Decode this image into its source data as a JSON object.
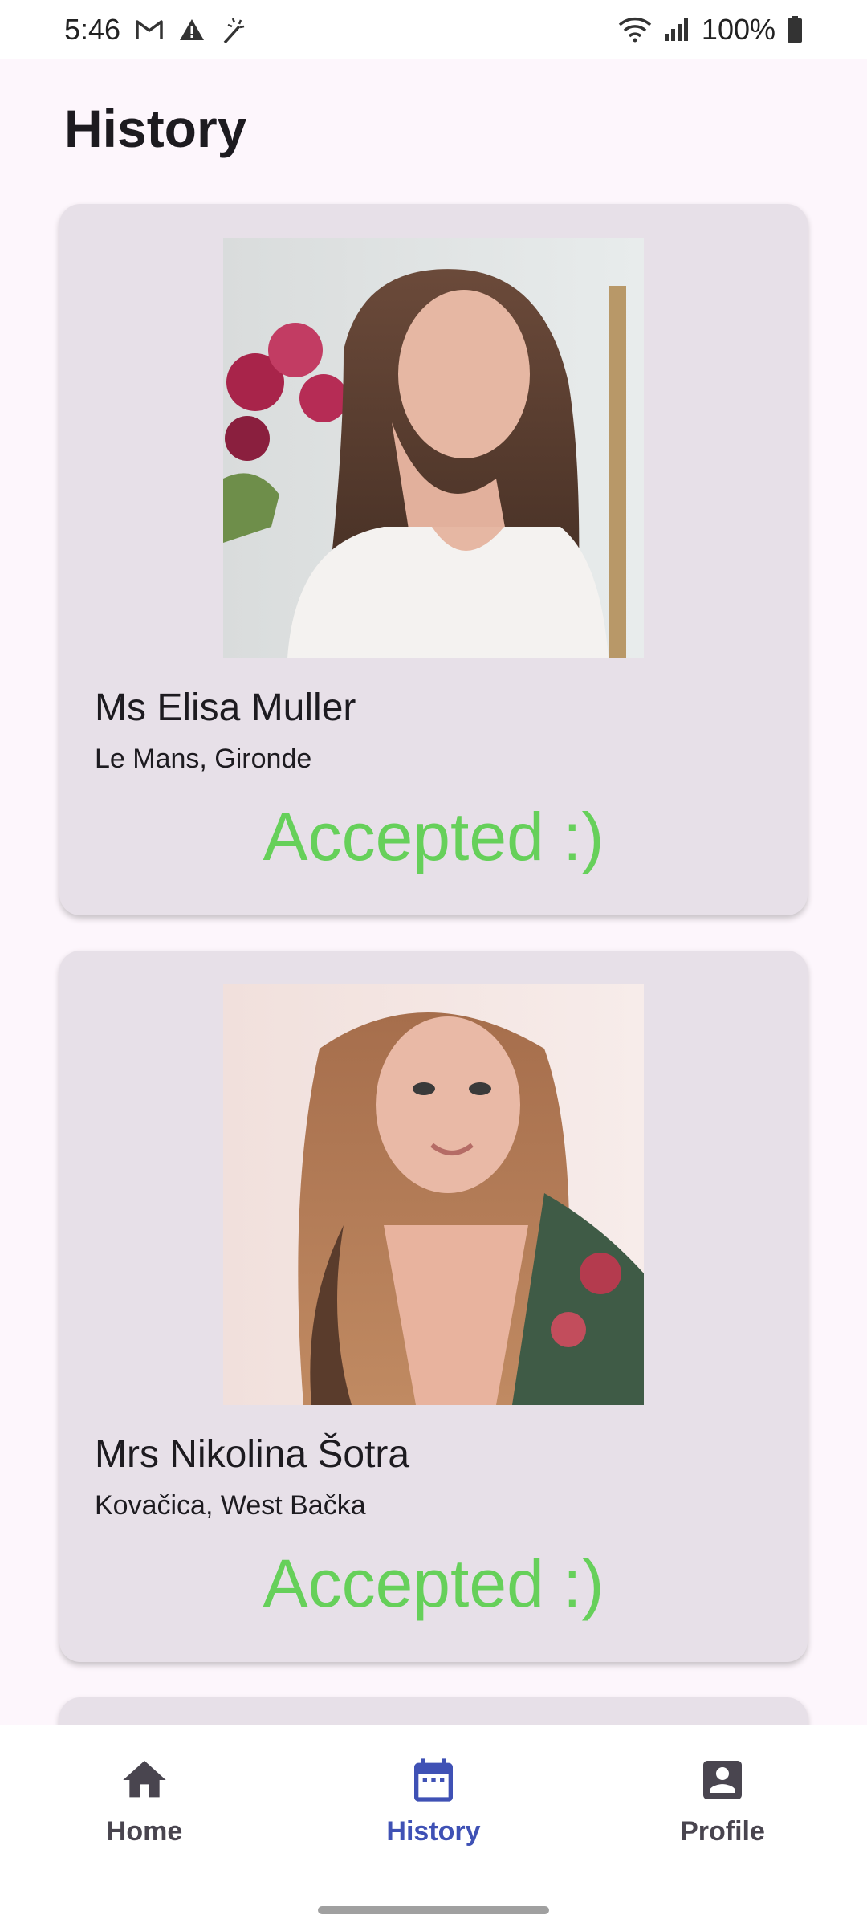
{
  "status_bar": {
    "time": "5:46",
    "battery": "100%",
    "icons": [
      "gmail-icon",
      "warning-icon",
      "magic-wand-icon",
      "wifi-icon",
      "signal-icon",
      "battery-icon"
    ]
  },
  "page": {
    "title": "History"
  },
  "history": [
    {
      "name": "Ms Elisa Muller",
      "location": "Le Mans, Gironde",
      "status": "Accepted :)"
    },
    {
      "name": "Mrs Nikolina Šotra",
      "location": "Kovačica, West Bačka",
      "status": "Accepted :)"
    }
  ],
  "colors": {
    "accepted": "#66d05a",
    "active_nav": "#3f51b5",
    "card": "#e7e0e8",
    "background": "#fdf6fc"
  },
  "nav": {
    "home": "Home",
    "history": "History",
    "profile": "Profile",
    "active": "history"
  }
}
